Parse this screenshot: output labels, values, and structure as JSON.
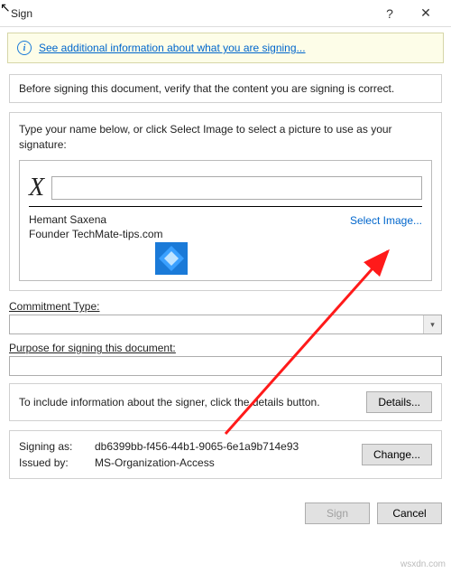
{
  "window": {
    "title": "Sign",
    "help_symbol": "?",
    "close_symbol": "✕"
  },
  "infobar": {
    "link_text": "See additional information about what you are signing..."
  },
  "verify_text": "Before signing this document, verify that the content you are signing is correct.",
  "sig_prompt": "Type your name below, or click Select Image to select a picture to use as your signature:",
  "signature": {
    "x_mark": "X",
    "input_value": "",
    "select_image": "Select Image...",
    "signer_name": "Hemant Saxena",
    "signer_title": "Founder TechMate-tips.com"
  },
  "commitment": {
    "label": "Commitment Type:",
    "value": ""
  },
  "purpose": {
    "label": "Purpose for signing this document:",
    "value": ""
  },
  "details": {
    "text": "To include information about the signer, click the details button.",
    "button": "Details..."
  },
  "identity": {
    "signing_as_label": "Signing as:",
    "signing_as_value": "db6399bb-f456-44b1-9065-6e1a9b714e93",
    "issued_by_label": "Issued by:",
    "issued_by_value": "MS-Organization-Access",
    "change_button": "Change..."
  },
  "footer": {
    "sign": "Sign",
    "cancel": "Cancel"
  },
  "watermark": "wsxdn.com"
}
